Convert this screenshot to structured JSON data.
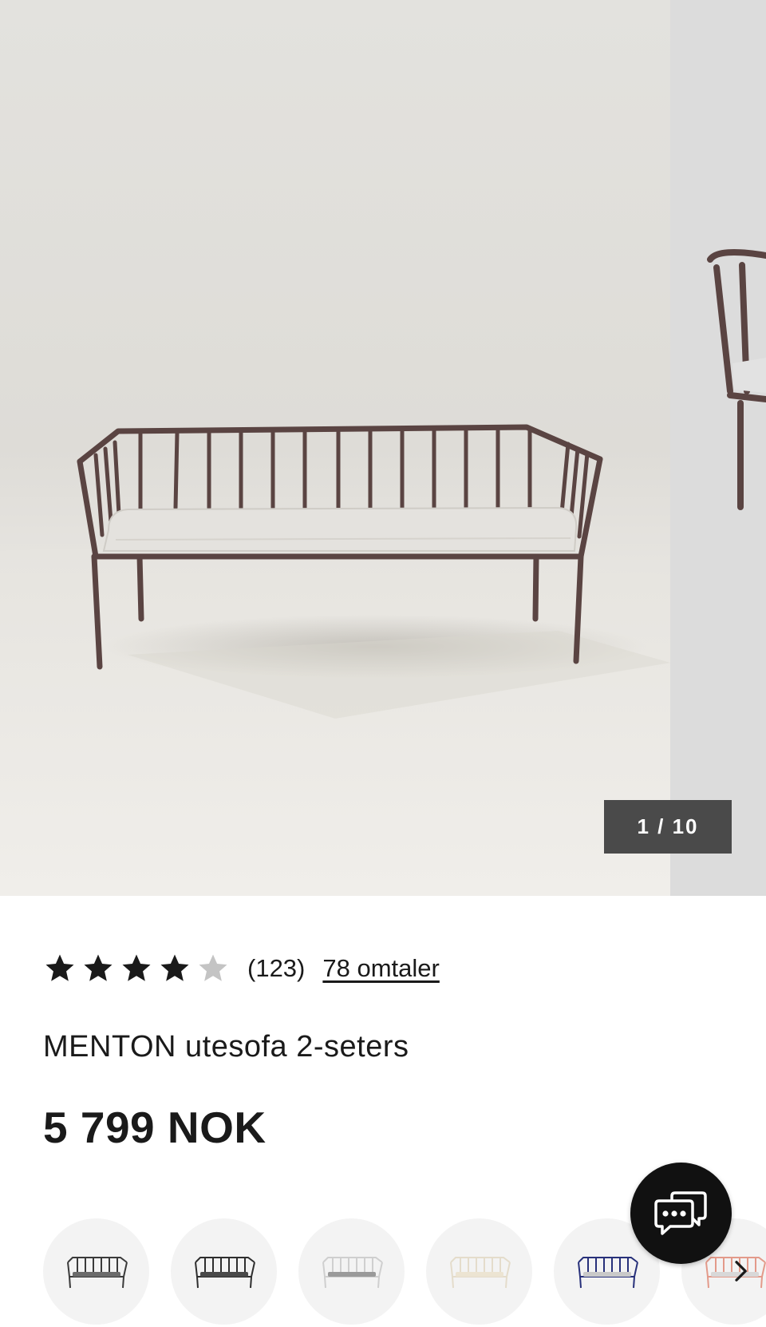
{
  "gallery": {
    "counter": "1 / 10",
    "main_image": "MENTON outdoor 2-seat sofa photo",
    "next_image": "MENTON chair photo (partial)"
  },
  "product": {
    "rating": 4,
    "rating_max": 5,
    "rating_count": "(123)",
    "reviews_link": "78 omtaler",
    "title": "MENTON utesofa 2-seters",
    "price": "5 799 NOK"
  },
  "variants": [
    {
      "frame_color": "#3a3a3a",
      "cushion_color": "#6b6b6b"
    },
    {
      "frame_color": "#2e2e2e",
      "cushion_color": "#4a4a4a"
    },
    {
      "frame_color": "#cfcfcf",
      "cushion_color": "#9a9a9a"
    },
    {
      "frame_color": "#e4dccb",
      "cushion_color": "#ece4d2"
    },
    {
      "frame_color": "#27307a",
      "cushion_color": "#c9c9c9"
    },
    {
      "frame_color": "#e39a8a",
      "cushion_color": "#d8d8d8"
    }
  ],
  "icons": {
    "star_filled": "star-icon",
    "star_empty": "star-empty-icon",
    "chat": "chat-icon",
    "next": "chevron-right-icon"
  },
  "colors": {
    "text": "#1a1a1a",
    "counter_bg": "#4a4a4a",
    "chat_bg": "#111111",
    "star_empty": "#c4c4c4",
    "sofa_frame": "#5a4442"
  }
}
